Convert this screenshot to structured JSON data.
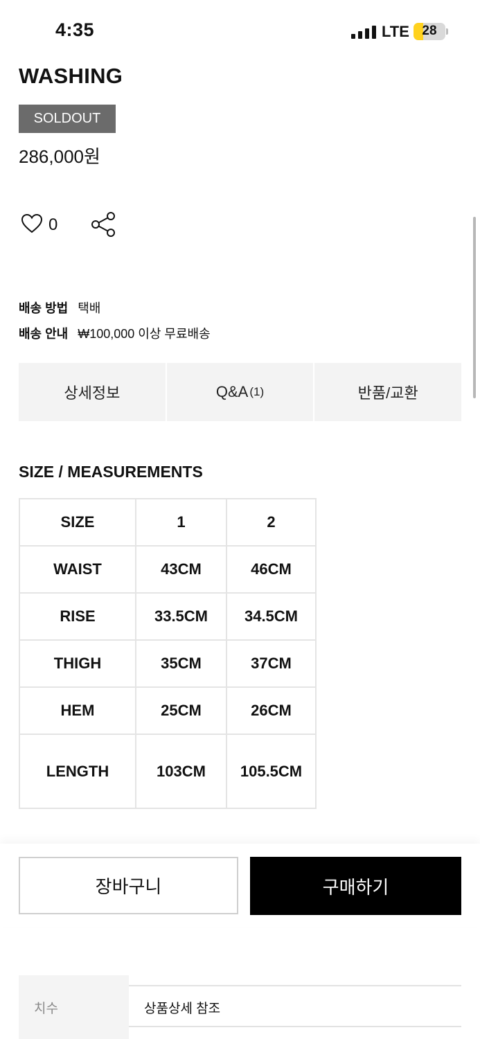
{
  "status_bar": {
    "time": "4:35",
    "network": "LTE",
    "battery": "28"
  },
  "product": {
    "title": "WASHING",
    "badge": "SOLDOUT",
    "price": "286,000원",
    "like_count": "0"
  },
  "shipping": [
    {
      "label": "배송 방법",
      "value": "택배"
    },
    {
      "label": "배송 안내",
      "value": "₩100,000 이상 무료배송"
    }
  ],
  "tabs": [
    {
      "label": "상세정보",
      "count": ""
    },
    {
      "label": "Q&A",
      "count": "(1)"
    },
    {
      "label": "반품/교환",
      "count": ""
    }
  ],
  "size_section": {
    "title": "SIZE / MEASUREMENTS",
    "rows": [
      [
        "SIZE",
        "1",
        "2"
      ],
      [
        "WAIST",
        "43CM",
        "46CM"
      ],
      [
        "RISE",
        "33.5CM",
        "34.5CM"
      ],
      [
        "THIGH",
        "35CM",
        "37CM"
      ],
      [
        "HEM",
        "25CM",
        "26CM"
      ],
      [
        "LENGTH",
        "103CM",
        "105.5CM"
      ]
    ]
  },
  "actions": {
    "cart": "장바구니",
    "buy": "구매하기"
  },
  "info": {
    "label": "치수",
    "value": "상품상세 참조"
  },
  "colors": {
    "badge_bg": "#6b6b6b",
    "buy_bg": "#000000",
    "tab_bg": "#f3f3f3",
    "battery": "#ffd21f"
  }
}
